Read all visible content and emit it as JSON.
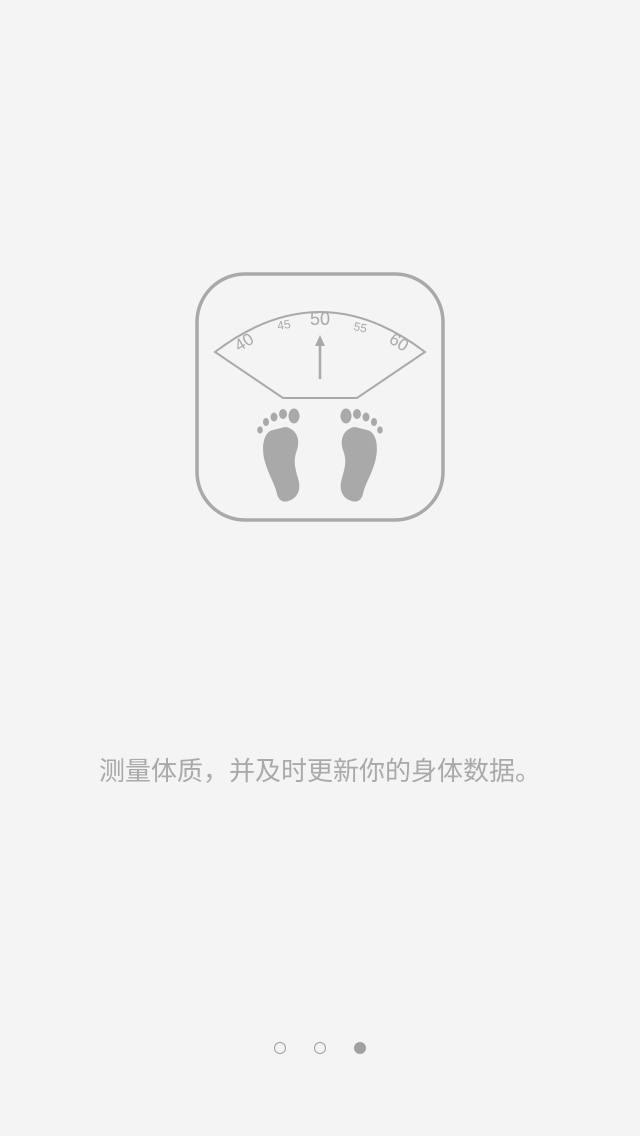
{
  "onboarding": {
    "caption": "测量体质，并及时更新你的身体数据。",
    "scale_dial": {
      "tick_labels": [
        "40",
        "45",
        "50",
        "55",
        "60"
      ]
    },
    "pager": {
      "page_count": 3,
      "current_page": 3
    }
  },
  "colors": {
    "background": "#f4f4f4",
    "icon_gray": "#a9a9a9",
    "text_gray": "#a9a9a9"
  },
  "icons": [
    "bathroom-scale-icon",
    "footprints-icon",
    "needle-arrow-icon"
  ]
}
